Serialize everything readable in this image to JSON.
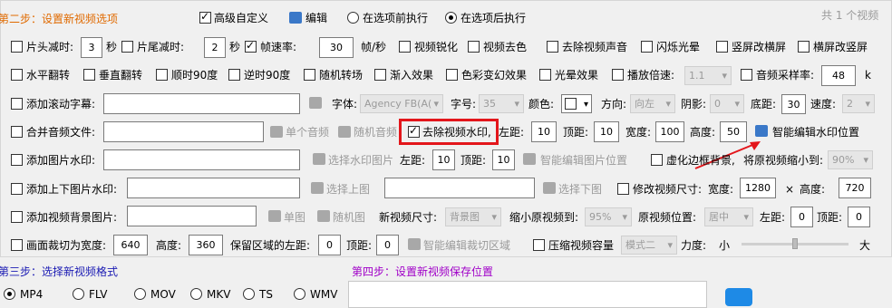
{
  "header": {
    "step2_title": "第二步：设置新视频选项",
    "advanced_custom": "高级自定义",
    "edit": "编辑",
    "exec_before": "在选项前执行",
    "exec_after": "在选项后执行",
    "total": "共 1 个视频"
  },
  "row1": {
    "head_cut": "片头减时:",
    "head_val": "3",
    "head_unit": "秒",
    "tail_cut": "片尾减时:",
    "tail_val": "2",
    "tail_unit": "秒",
    "fps": "帧速率:",
    "fps_val": "30",
    "fps_unit": "帧/秒",
    "sharpen": "视频锐化",
    "decolor": "视频去色",
    "remove_audio": "去除视频声音",
    "flash": "闪烁光晕",
    "v2h": "竖屏改横屏",
    "h2v": "横屏改竖屏"
  },
  "row2": {
    "hflip": "水平翻转",
    "vflip": "垂直翻转",
    "rot90": "顺时90度",
    "ccw90": "逆时90度",
    "random_scene": "随机转场",
    "fade_in": "渐入效果",
    "color_change": "色彩变幻效果",
    "halo": "光晕效果",
    "speed": "播放倍速:",
    "speed_val": "1.1",
    "sample_rate": "音频采样率:",
    "sample_val": "48",
    "sample_unit": "k"
  },
  "row3": {
    "scroll_sub": "添加滚动字幕:",
    "font_label": "字体:",
    "font_val": "Agency FB(A(",
    "size_label": "字号:",
    "size_val": "35",
    "color_label": "颜色:",
    "dir_label": "方向:",
    "dir_val": "向左",
    "shadow_label": "阴影:",
    "shadow_val": "0",
    "bottom_label": "底距:",
    "bottom_val": "30",
    "speed_label": "速度:",
    "speed_val": "2"
  },
  "row4": {
    "merge_audio": "合并音频文件:",
    "single_audio": "单个音频",
    "random_audio": "随机音频",
    "remove_wm": "去除视频水印,",
    "left_label": "左距:",
    "left_val": "10",
    "top_label": "顶距:",
    "top_val": "10",
    "width_label": "宽度:",
    "width_val": "100",
    "height_label": "高度:",
    "height_val": "50",
    "smart_wm": "智能编辑水印位置"
  },
  "row5": {
    "img_wm": "添加图片水印:",
    "select_wm_img": "选择水印图片",
    "left_label": "左距:",
    "left_val": "10",
    "top_label": "顶距:",
    "top_val": "10",
    "smart_img": "智能编辑图片位置",
    "blur_border": "虚化边框背景,",
    "shrink_label": "将原视频缩小到:",
    "shrink_val": "90%"
  },
  "row6": {
    "tb_img_wm": "添加上下图片水印:",
    "select_top": "选择上图",
    "select_bottom": "选择下图",
    "modify_size": "修改视频尺寸:",
    "width_label": "宽度:",
    "width_val": "1280",
    "times": "×",
    "height_label": "高度:",
    "height_val": "720"
  },
  "row7": {
    "bg_img": "添加视频背景图片:",
    "single_img": "单图",
    "random_img": "随机图",
    "new_size_label": "新视频尺寸:",
    "new_size_val": "背景图",
    "shrink_label": "缩小原视频到:",
    "shrink_val": "95%",
    "pos_label": "原视频位置:",
    "pos_val": "居中",
    "left_label": "左距:",
    "left_val": "0",
    "top_label": "顶距:",
    "top_val": "0"
  },
  "row8": {
    "crop_width": "画面裁切为宽度:",
    "crop_width_val": "640",
    "height_label": "高度:",
    "height_val": "360",
    "keep_left": "保留区域的左距:",
    "keep_left_val": "0",
    "top_label": "顶距:",
    "top_val": "0",
    "smart_crop": "智能编辑裁切区域",
    "compress": "压缩视频容量",
    "mode_val": "模式二",
    "strength": "力度:",
    "small": "小",
    "big": "大",
    "strength_level": 0.5
  },
  "footer": {
    "step3_title": "第三步：选择新视频格式",
    "step4_title": "第四步：设置新视频保存位置",
    "formats": [
      "MP4",
      "FLV",
      "MOV",
      "MKV",
      "TS",
      "WMV"
    ]
  },
  "colors": {
    "highlight": "#e3161b",
    "step_blue": "#1a1ab3",
    "step_purple": "#a000c8",
    "step_orange": "#e06a00"
  }
}
